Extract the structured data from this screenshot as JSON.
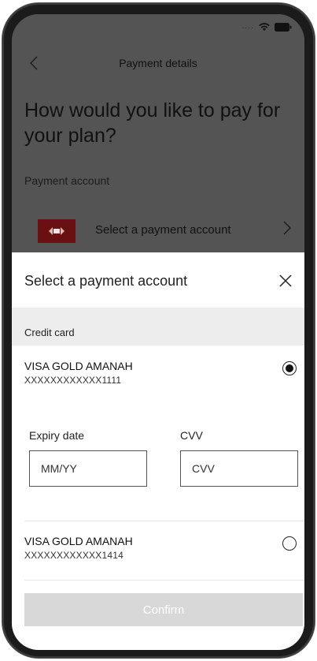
{
  "status_bar": {
    "signal": "....",
    "wifi_icon": "wifi-icon",
    "battery_icon": "battery-icon"
  },
  "nav": {
    "back_icon": "chevron-left-icon",
    "title": "Payment details"
  },
  "page": {
    "heading": "How would you like to pay for your plan?",
    "payment_account_label": "Payment account",
    "select_account_row": "Select a payment account"
  },
  "sheet": {
    "title": "Select a payment account",
    "close_icon": "close-icon",
    "group_label": "Credit card",
    "cards": [
      {
        "name": "VISA GOLD AMANAH",
        "number": "XXXXXXXXXXXX1111",
        "selected": true
      },
      {
        "name": "VISA GOLD AMANAH",
        "number": "XXXXXXXXXXXX1414",
        "selected": false
      }
    ],
    "expiry": {
      "label": "Expiry date",
      "placeholder": "MM/YY"
    },
    "cvv": {
      "label": "CVV",
      "placeholder": "CVV"
    },
    "confirm_label": "Confirm"
  },
  "colors": {
    "overlay": "#545454",
    "brand_logo": "#6a0f12",
    "group_header_bg": "#ededed",
    "confirm_disabled_bg": "#d8d8d8"
  }
}
